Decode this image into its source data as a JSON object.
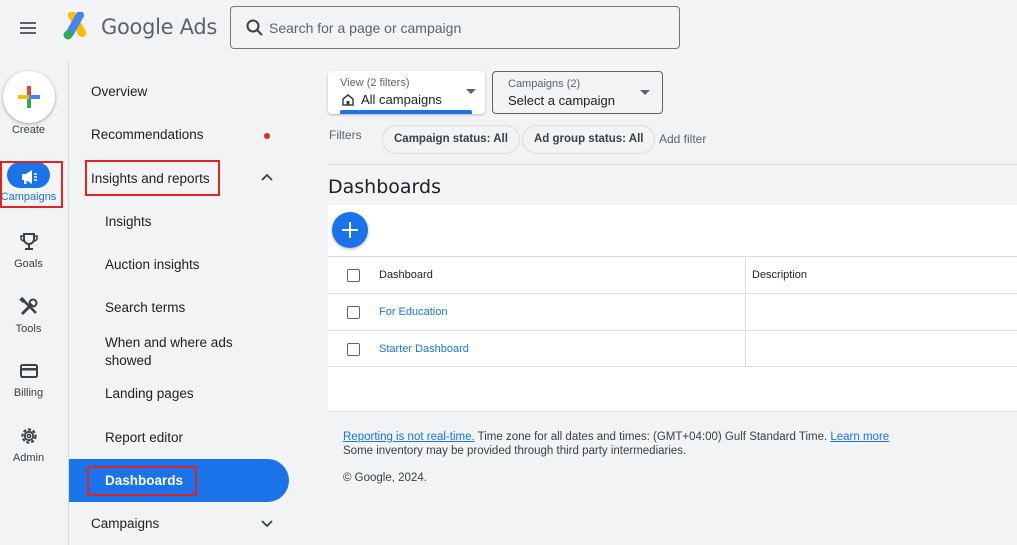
{
  "app": {
    "title": "Google Ads"
  },
  "search": {
    "placeholder": "Search for a page or campaign"
  },
  "rail": {
    "create_label": "Create",
    "items": [
      {
        "label": "Campaigns",
        "icon": "megaphone-icon",
        "active": true
      },
      {
        "label": "Goals",
        "icon": "trophy-icon"
      },
      {
        "label": "Tools",
        "icon": "tools-icon"
      },
      {
        "label": "Billing",
        "icon": "credit-card-icon"
      },
      {
        "label": "Admin",
        "icon": "gear-icon"
      }
    ]
  },
  "nav": {
    "items": [
      {
        "label": "Overview"
      },
      {
        "label": "Recommendations",
        "badge": "red-dot"
      },
      {
        "label": "Insights and reports",
        "expanded": true
      },
      {
        "label": "Insights"
      },
      {
        "label": "Auction insights"
      },
      {
        "label": "Search terms"
      },
      {
        "label": "When and where ads showed"
      },
      {
        "label": "Landing pages"
      },
      {
        "label": "Report editor"
      },
      {
        "label": "Dashboards",
        "active": true
      },
      {
        "label": "Campaigns",
        "expanded": false
      }
    ]
  },
  "view_selector": {
    "caption": "View (2 filters)",
    "value": "All campaigns"
  },
  "campaign_selector": {
    "caption": "Campaigns (2)",
    "value": "Select a campaign"
  },
  "filters": {
    "label": "Filters",
    "chips": [
      "Campaign status: All",
      "Ad group status: All"
    ],
    "add_label": "Add filter"
  },
  "page": {
    "title": "Dashboards"
  },
  "table": {
    "columns": [
      "Dashboard",
      "Description"
    ],
    "rows": [
      {
        "name": "For Education",
        "description": ""
      },
      {
        "name": "Starter Dashboard",
        "description": ""
      }
    ]
  },
  "footer": {
    "realtime_link": "Reporting is not real-time.",
    "timezone_text": " Time zone for all dates and times: (GMT+04:00) Gulf Standard Time. ",
    "learn_more": "Learn more",
    "inventory_note": "Some inventory may be provided through third party intermediaries.",
    "copyright": "© Google, 2024."
  },
  "colors": {
    "accent": "#1a73e8",
    "annotation": "#e02424",
    "badge": "#d93025"
  }
}
